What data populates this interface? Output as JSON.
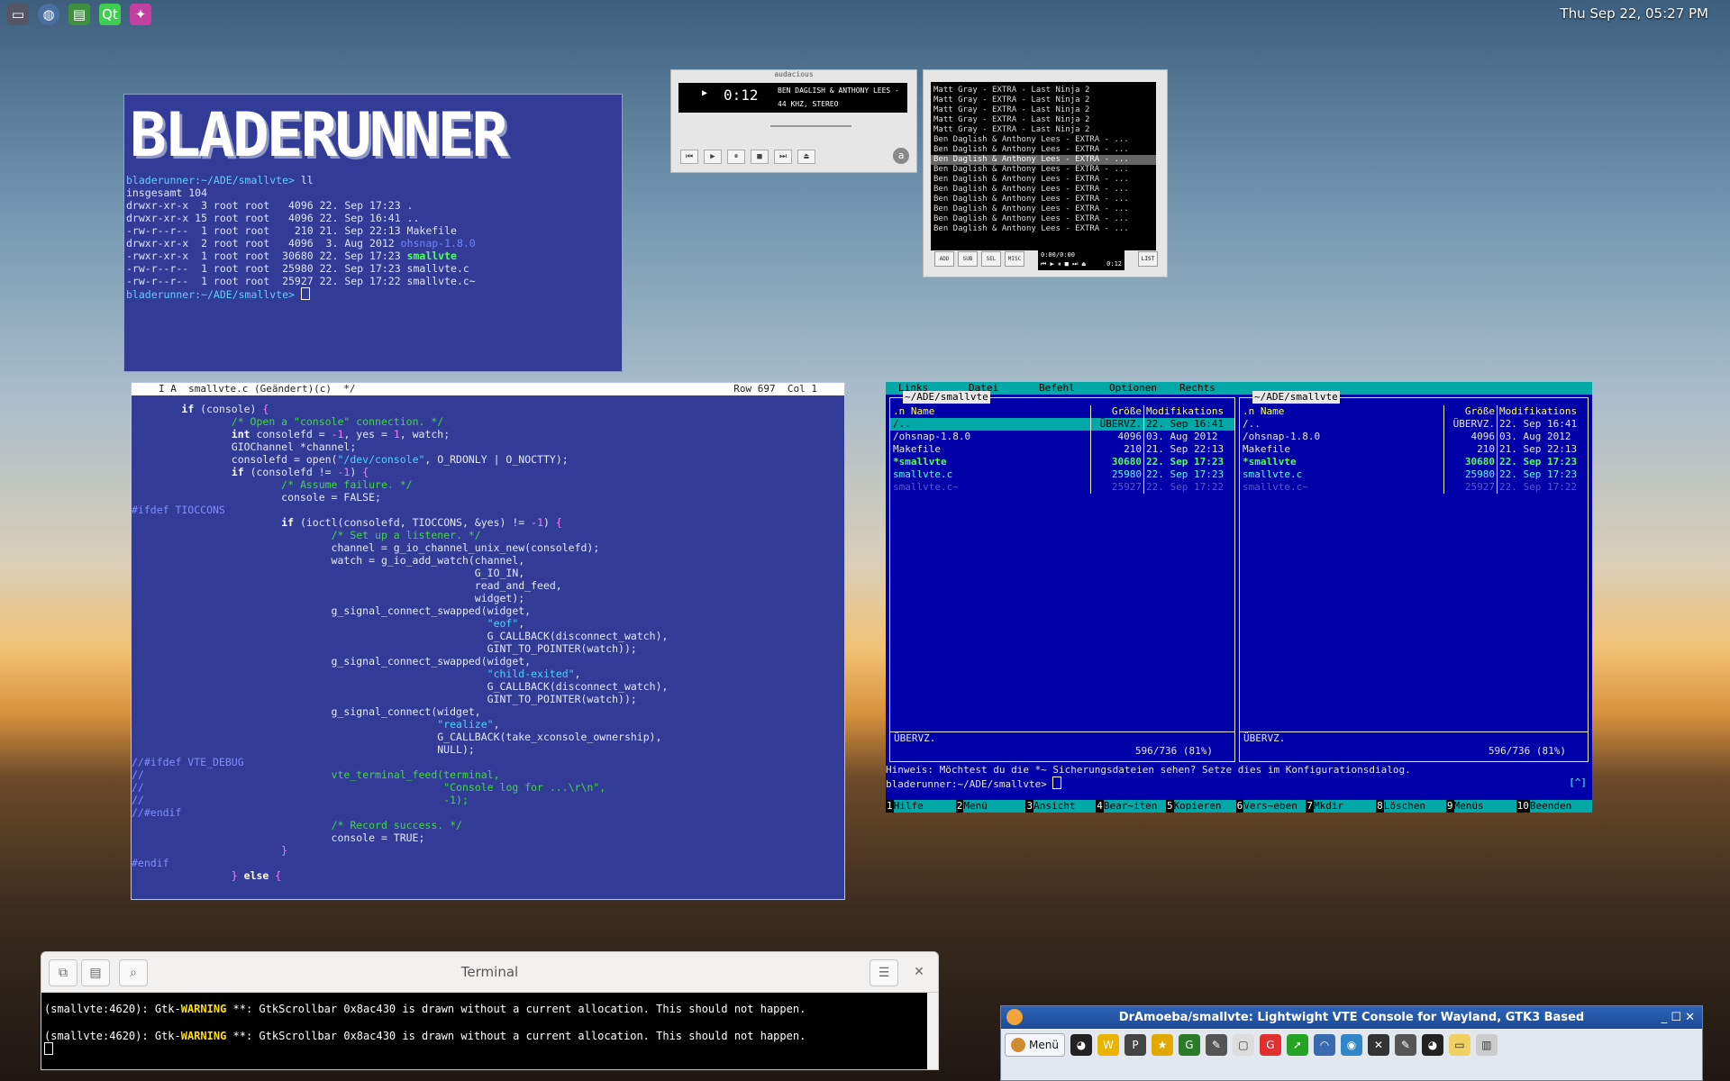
{
  "clock": "Thu Sep 22, 05:27 PM",
  "top_icons": [
    "screen-icon",
    "globe-icon",
    "filemanager-icon",
    "qt-icon",
    "app-icon"
  ],
  "term1": {
    "banner": "BLADERUNNER",
    "lines": [
      {
        "t": "bladerunner:~/ADE/smallvte> ll",
        "c": ""
      },
      {
        "t": "insgesamt 104",
        "c": ""
      },
      {
        "t": "drwxr-xr-x  3 root root   4096 22. Sep 17:23 .",
        "c": ""
      },
      {
        "t": "drwxr-xr-x 15 root root   4096 22. Sep 16:41 ..",
        "c": ""
      },
      {
        "t": "-rw-r--r--  1 root root    210 21. Sep 22:13 Makefile",
        "c": ""
      },
      {
        "t": "drwxr-xr-x  2 root root   4096  3. Aug 2012 ",
        "c": "",
        "x": "ohsnap-1.8.0",
        "xc": "bl"
      },
      {
        "t": "-rwxr-xr-x  1 root root  30680 22. Sep 17:23 ",
        "c": "",
        "x": "smallvte",
        "xc": "gn"
      },
      {
        "t": "-rw-r--r--  1 root root  25980 22. Sep 17:23 smallvte.c",
        "c": ""
      },
      {
        "t": "-rw-r--r--  1 root root  25927 22. Sep 17:22 smallvte.c~",
        "c": ""
      },
      {
        "t": "bladerunner:~/ADE/smallvte> ",
        "c": "",
        "cursor": true
      }
    ]
  },
  "winamp": {
    "title": "audacious",
    "time": "0:12",
    "song": "BEN DAGLISH & ANTHONY LEES - EXTRA",
    "rate": "44 KHZ, STEREO",
    "buttons": [
      "⏮",
      "▶",
      "⏸",
      "■",
      "⏭",
      "⏏"
    ]
  },
  "playlist": {
    "items": [
      "Matt Gray - EXTRA - Last Ninja 2",
      "Matt Gray - EXTRA - Last Ninja 2",
      "Matt Gray - EXTRA - Last Ninja 2",
      "Matt Gray - EXTRA - Last Ninja 2",
      "Matt Gray - EXTRA - Last Ninja 2",
      "Ben Daglish & Anthony Lees - EXTRA - ...",
      "Ben Daglish & Anthony Lees - EXTRA - ...",
      "Ben Daglish & Anthony Lees - EXTRA - ...",
      "Ben Daglish & Anthony Lees - EXTRA - ...",
      "Ben Daglish & Anthony Lees - EXTRA - ...",
      "Ben Daglish & Anthony Lees - EXTRA - ...",
      "Ben Daglish & Anthony Lees - EXTRA - ...",
      "Ben Daglish & Anthony Lees - EXTRA - ...",
      "Ben Daglish & Anthony Lees - EXTRA - ...",
      "Ben Daglish & Anthony Lees - EXTRA - ..."
    ],
    "selected_index": 7,
    "buttons": [
      "ADD",
      "SUB",
      "SEL",
      "MISC"
    ],
    "list_button": "LIST",
    "mini_time": "0:00/0:00",
    "mini_time2": "0:12"
  },
  "editor": {
    "status_left": "I A  smallvte.c (Geändert)(c)  */",
    "status_right": "Row 697  Col 1"
  },
  "mc": {
    "menu": [
      "Links",
      "Datei",
      "Befehl",
      "Optionen",
      "Rechts"
    ],
    "left": {
      "path": " ~/ADE/smallvte ",
      "hdr": [
        ".n",
        "Name",
        "Größe",
        "Modifikations"
      ],
      "rows": [
        {
          "n": "/..",
          "s": "ÜBERVZ.",
          "d": "22. Sep 16:41",
          "cls": "hi"
        },
        {
          "n": "/ohsnap-1.8.0",
          "s": "4096",
          "d": "03. Aug 2012",
          "cls": ""
        },
        {
          "n": " Makefile",
          "s": "210",
          "d": "21. Sep 22:13",
          "cls": ""
        },
        {
          "n": "*smallvte",
          "s": "30680",
          "d": "22. Sep 17:23",
          "cls": "ex"
        },
        {
          "n": " smallvte.c",
          "s": "25980",
          "d": "22. Sep 17:23",
          "cls": "cyf"
        },
        {
          "n": " smallvte.c~",
          "s": "25927",
          "d": "22. Sep 17:22",
          "cls": "dim"
        }
      ],
      "foot": "ÜBERVZ.",
      "usage": "596/736 (81%)"
    },
    "right": {
      "path": " ~/ADE/smallvte ",
      "hdr": [
        ".n",
        "Name",
        "Größe",
        "Modifikations"
      ],
      "rows": [
        {
          "n": "/..",
          "s": "ÜBERVZ.",
          "d": "22. Sep 16:41",
          "cls": ""
        },
        {
          "n": "/ohsnap-1.8.0",
          "s": "4096",
          "d": "03. Aug 2012",
          "cls": ""
        },
        {
          "n": " Makefile",
          "s": "210",
          "d": "21. Sep 22:13",
          "cls": ""
        },
        {
          "n": "*smallvte",
          "s": "30680",
          "d": "22. Sep 17:23",
          "cls": "ex"
        },
        {
          "n": " smallvte.c",
          "s": "25980",
          "d": "22. Sep 17:23",
          "cls": "cyf"
        },
        {
          "n": " smallvte.c~",
          "s": "25927",
          "d": "22. Sep 17:22",
          "cls": "dim"
        }
      ],
      "foot": "ÜBERVZ.",
      "usage": "596/736 (81%)"
    },
    "hint": "Hinweis: Möchtest du die *~ Sicherungsdateien sehen? Setze dies im Konfigurationsdialog.",
    "prompt": "bladerunner:~/ADE/smallvte> ",
    "keys": [
      [
        "1",
        "Hilfe"
      ],
      [
        "2",
        "Menü"
      ],
      [
        "3",
        "Ansicht"
      ],
      [
        "4",
        "Bear~iten"
      ],
      [
        "5",
        "Kopieren"
      ],
      [
        "6",
        "Vers~eben"
      ],
      [
        "7",
        "Mkdir"
      ],
      [
        "8",
        "Löschen"
      ],
      [
        "9",
        "Menüs"
      ],
      [
        "10",
        "Beenden"
      ]
    ]
  },
  "terminal": {
    "title": "Terminal",
    "line_prefix": "(smallvte:4620): Gtk-",
    "warn": "WARNING",
    "line_suffix": " **: GtkScrollbar 0x8ac430 is drawn without a current allocation. This should not happen."
  },
  "taskbar": {
    "title": "DrAmoeba/smallvte: Lightwight VTE Console for Wayland, GTK3 Based",
    "menu": "Menü"
  }
}
